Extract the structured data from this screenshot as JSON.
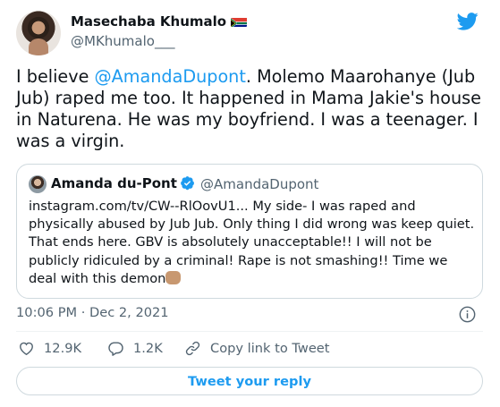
{
  "author": {
    "display_name": "Masechaba Khumalo",
    "handle": "@MKhumalo___",
    "flag_icon": "south-africa-flag-icon"
  },
  "tweet": {
    "text_before_mention": "I believe ",
    "mention": "@AmandaDupont",
    "text_after_mention": ". Molemo Maarohanye (Jub Jub) raped me too. It happened in Mama Jakie's house in Naturena. He was my boyfriend. I was a teenager. I was a virgin."
  },
  "quoted_tweet": {
    "display_name": "Amanda du-Pont",
    "handle": "@AmandaDupont",
    "text": "instagram.com/tv/CW--RlOovU1... My side- I was raped and physically abused by Jub Jub. Only thing I did wrong was keep quiet. That ends here. GBV is absolutely unacceptable!! I will not be publicly ridiculed by a criminal! Rape is not smashing!! Time we deal with this demon",
    "emoji_icon": "raised-fist-icon"
  },
  "meta": {
    "timestamp": "10:06 PM · Dec 2, 2021"
  },
  "actions": {
    "likes": "12.9K",
    "replies": "1.2K",
    "copy_link": "Copy link to Tweet"
  },
  "reply_button_label": "Tweet your reply",
  "colors": {
    "accent": "#1d9bf0",
    "text": "#0f1419",
    "muted": "#536471",
    "border": "#cfd9de"
  }
}
